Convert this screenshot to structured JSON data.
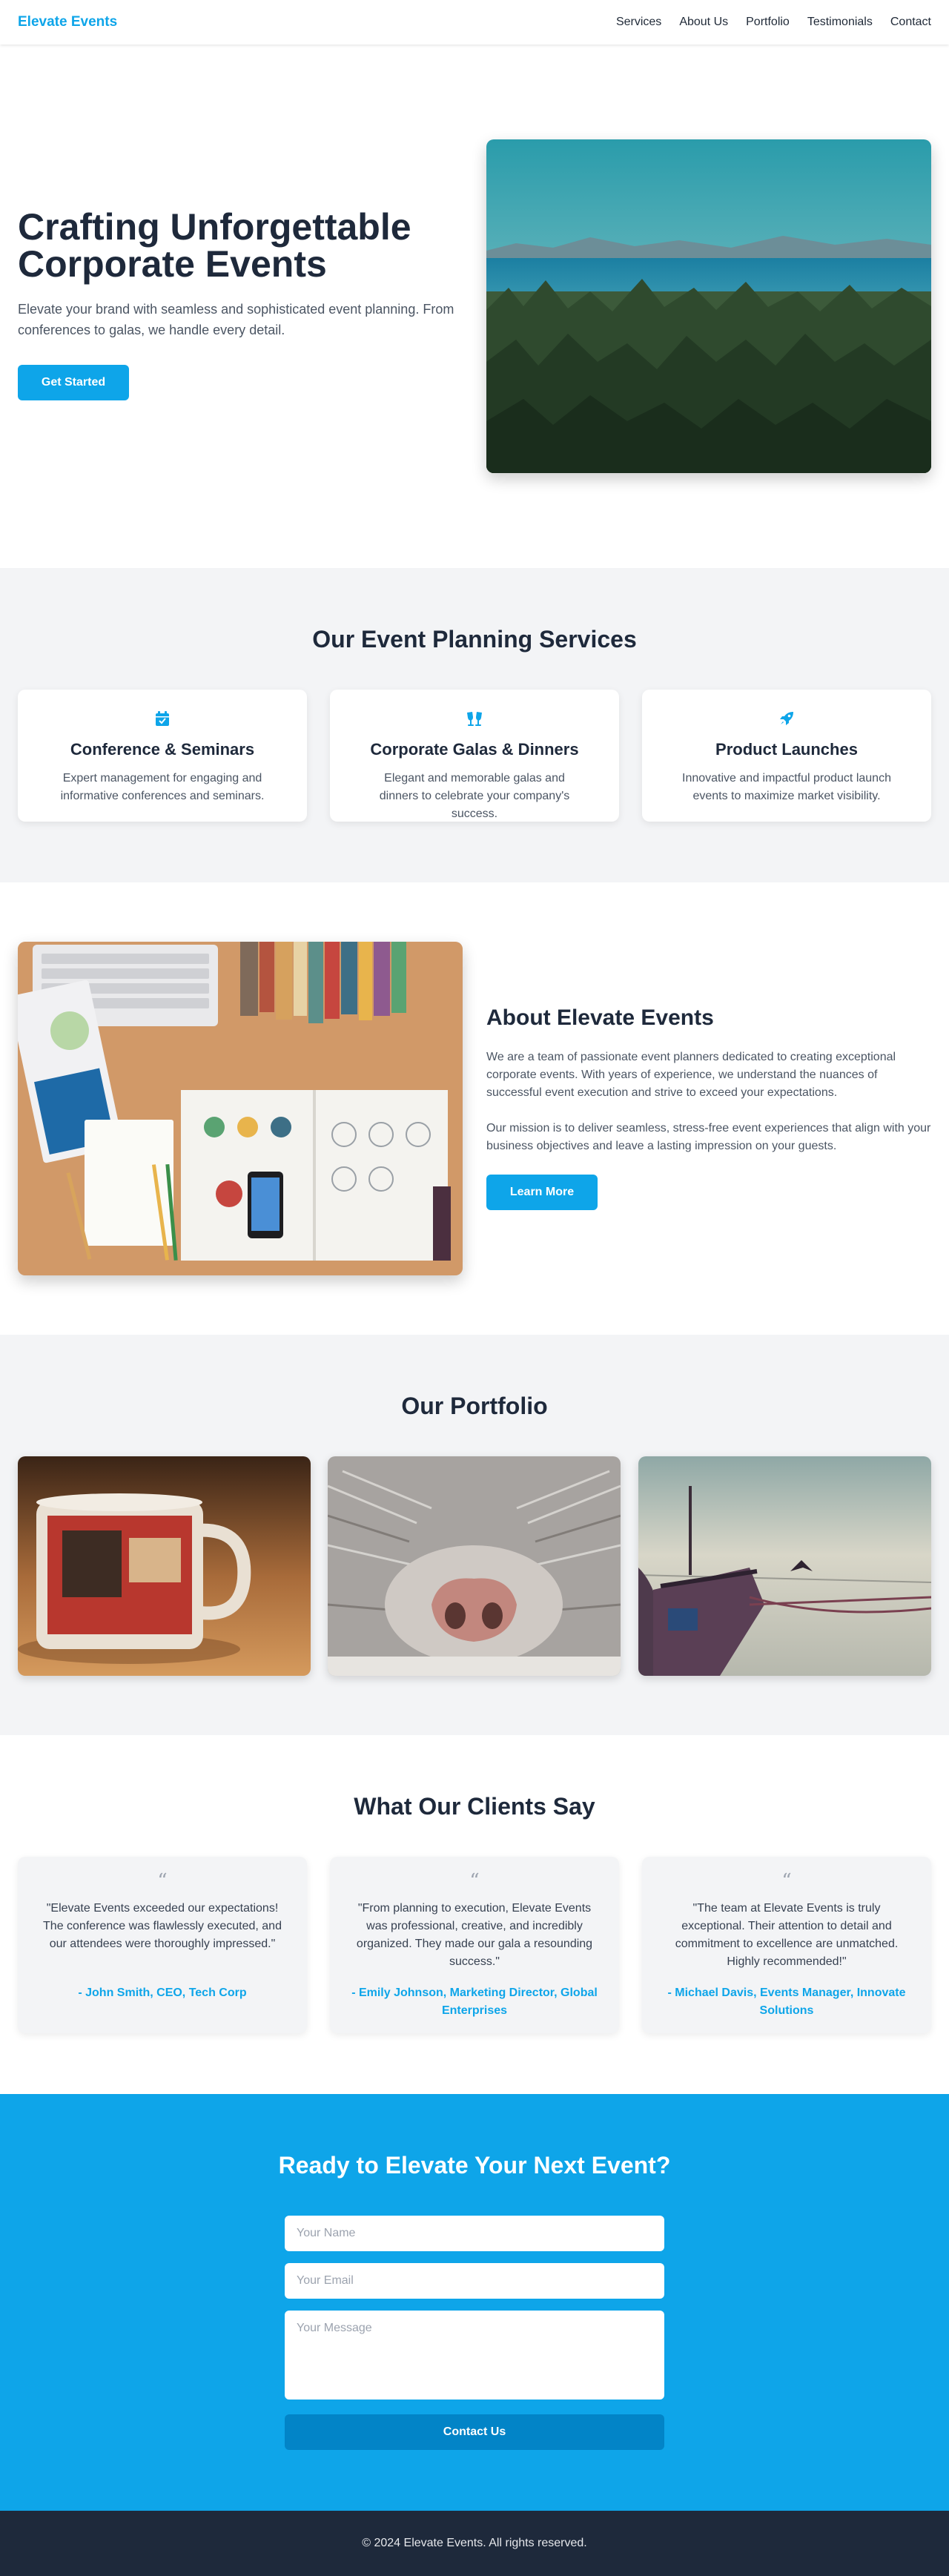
{
  "header": {
    "brand": "Elevate Events",
    "nav": [
      "Services",
      "About Us",
      "Portfolio",
      "Testimonials",
      "Contact"
    ]
  },
  "hero": {
    "title": "Crafting Unforgettable Corporate Events",
    "subtitle": "Elevate your brand with seamless and sophisticated event planning. From conferences to galas, we handle every detail.",
    "cta": "Get Started",
    "image_icon": "landscape-photo"
  },
  "services": {
    "title": "Our Event Planning Services",
    "items": [
      {
        "icon": "calendar-check-icon",
        "title": "Conference & Seminars",
        "desc": "Expert management for engaging and informative conferences and seminars."
      },
      {
        "icon": "champagne-glasses-icon",
        "title": "Corporate Galas & Dinners",
        "desc": "Elegant and memorable galas and dinners to celebrate your company's success."
      },
      {
        "icon": "rocket-icon",
        "title": "Product Launches",
        "desc": "Innovative and impactful product launch events to maximize market visibility."
      }
    ]
  },
  "about": {
    "title": "About Elevate Events",
    "p1": "We are a team of passionate event planners dedicated to creating exceptional corporate events. With years of experience, we understand the nuances of successful event execution and strive to exceed your expectations.",
    "p2": "Our mission is to deliver seamless, stress-free event experiences that align with your business objectives and leave a lasting impression on your guests.",
    "cta": "Learn More"
  },
  "portfolio": {
    "title": "Our Portfolio"
  },
  "testimonials": {
    "title": "What Our Clients Say",
    "quote_mark": "“",
    "items": [
      {
        "text": "\"Elevate Events exceeded our expectations! The conference was flawlessly executed, and our attendees were thoroughly impressed.\"",
        "author": "- John Smith, CEO, Tech Corp"
      },
      {
        "text": "\"From planning to execution, Elevate Events was professional, creative, and incredibly organized. They made our gala a resounding success.\"",
        "author": "- Emily Johnson, Marketing Director, Global Enterprises"
      },
      {
        "text": "\"The team at Elevate Events is truly exceptional. Their attention to detail and commitment to excellence are unmatched. Highly recommended!\"",
        "author": "- Michael Davis, Events Manager, Innovate Solutions"
      }
    ]
  },
  "contact": {
    "title": "Ready to Elevate Your Next Event?",
    "name_placeholder": "Your Name",
    "email_placeholder": "Your Email",
    "message_placeholder": "Your Message",
    "submit": "Contact Us"
  },
  "footer": {
    "text": "© 2024 Elevate Events. All rights reserved."
  },
  "colors": {
    "accent": "#0ea5e9",
    "accent_dark": "#0284c7",
    "heading": "#1e293b",
    "section_bg": "#f3f4f6",
    "footer_bg": "#1e293b"
  }
}
